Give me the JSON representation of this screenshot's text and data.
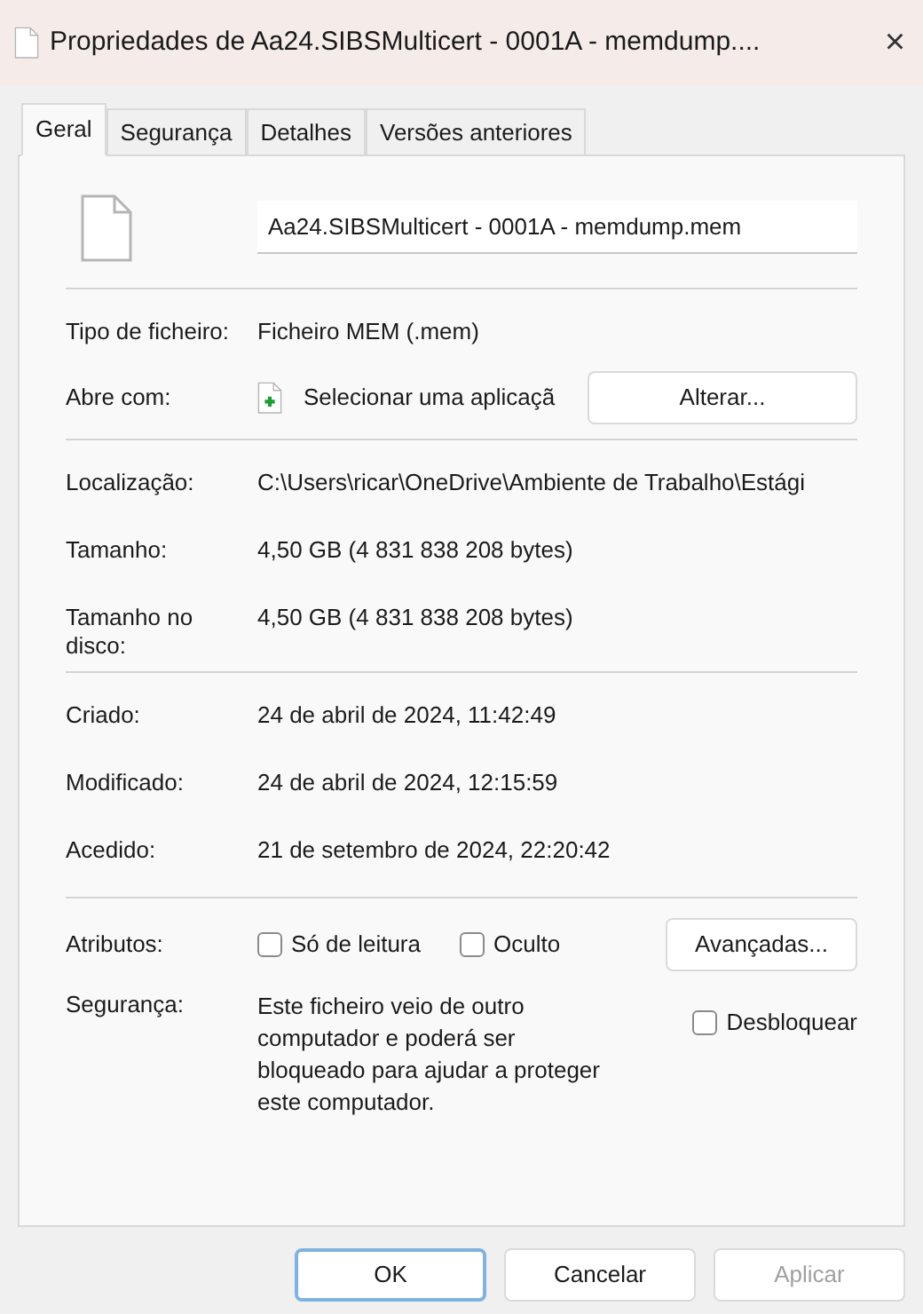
{
  "window": {
    "title": "Propriedades de Aa24.SIBSMulticert - 0001A - memdump....",
    "close": "×"
  },
  "tabs": [
    {
      "label": "Geral",
      "selected": true
    },
    {
      "label": "Segurança",
      "selected": false
    },
    {
      "label": "Detalhes",
      "selected": false
    },
    {
      "label": "Versões anteriores",
      "selected": false
    }
  ],
  "file_name": "Aa24.SIBSMulticert - 0001A - memdump.mem",
  "sections": [
    [
      {
        "kind": "text",
        "label": "Tipo de ficheiro:",
        "value": "Ficheiro MEM (.mem)"
      },
      {
        "kind": "open_with",
        "label": "Abre com:",
        "value": "Selecionar uma aplicaçã",
        "button": "Alterar..."
      }
    ],
    [
      {
        "kind": "text",
        "label": "Localização:",
        "value": "C:\\Users\\ricar\\OneDrive\\Ambiente de Trabalho\\Estági"
      },
      {
        "kind": "text",
        "label": "Tamanho:",
        "value": "4,50 GB (4 831 838 208 bytes)"
      },
      {
        "kind": "text",
        "label": "Tamanho no disco:",
        "value": "4,50 GB (4 831 838 208 bytes)"
      }
    ],
    [
      {
        "kind": "text",
        "label": "Criado:",
        "value": "24 de abril de 2024, 11:42:49"
      },
      {
        "kind": "text",
        "label": "Modificado:",
        "value": "24 de abril de 2024, 12:15:59"
      },
      {
        "kind": "text",
        "label": "Acedido:",
        "value": "21 de setembro de 2024, 22:20:42"
      }
    ],
    [
      {
        "kind": "attributes",
        "label": "Atributos:",
        "checkboxes": [
          {
            "label": "Só de leitura",
            "checked": false
          },
          {
            "label": "Oculto",
            "checked": false
          }
        ],
        "button": "Avançadas..."
      },
      {
        "kind": "security",
        "label": "Segurança:",
        "value": "Este ficheiro veio de outro computador e poderá ser bloqueado para ajudar a proteger este computador.",
        "checkbox": {
          "label": "Desbloquear",
          "checked": false
        }
      }
    ]
  ],
  "buttons": [
    {
      "label": "OK",
      "default": true,
      "disabled": false
    },
    {
      "label": "Cancelar",
      "default": false,
      "disabled": false
    },
    {
      "label": "Aplicar",
      "default": false,
      "disabled": true
    }
  ]
}
